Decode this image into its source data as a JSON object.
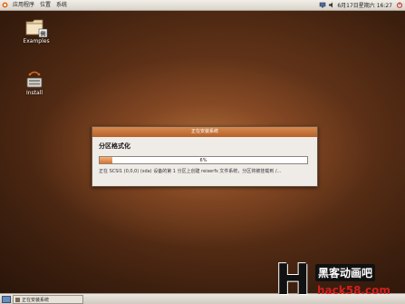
{
  "top_panel": {
    "menus": [
      "应用程序",
      "位置",
      "系统"
    ],
    "clock": "6月17日星期六 16:27"
  },
  "desktop": {
    "icons": [
      {
        "label": "Examples",
        "icon": "folder-icon"
      },
      {
        "label": "Install",
        "icon": "install-icon"
      }
    ]
  },
  "dialog": {
    "title": "正在安装系统",
    "heading": "分区格式化",
    "progress": {
      "percent": 6,
      "label": "6%"
    },
    "status": "正在 SCSI1 (0,0,0) (sda) 设备的第 1 分区上创建 reiserfs 文件系统，分区将被挂载到 /..."
  },
  "bottom_panel": {
    "task_label": "正在安装系统"
  },
  "watermark": {
    "letter": "H",
    "title": "黑客动画吧",
    "url": "hack58.com"
  },
  "colors": {
    "accent": "#d8722f",
    "titlebar": "#c0702f",
    "watermark_red": "#d21f1f"
  }
}
